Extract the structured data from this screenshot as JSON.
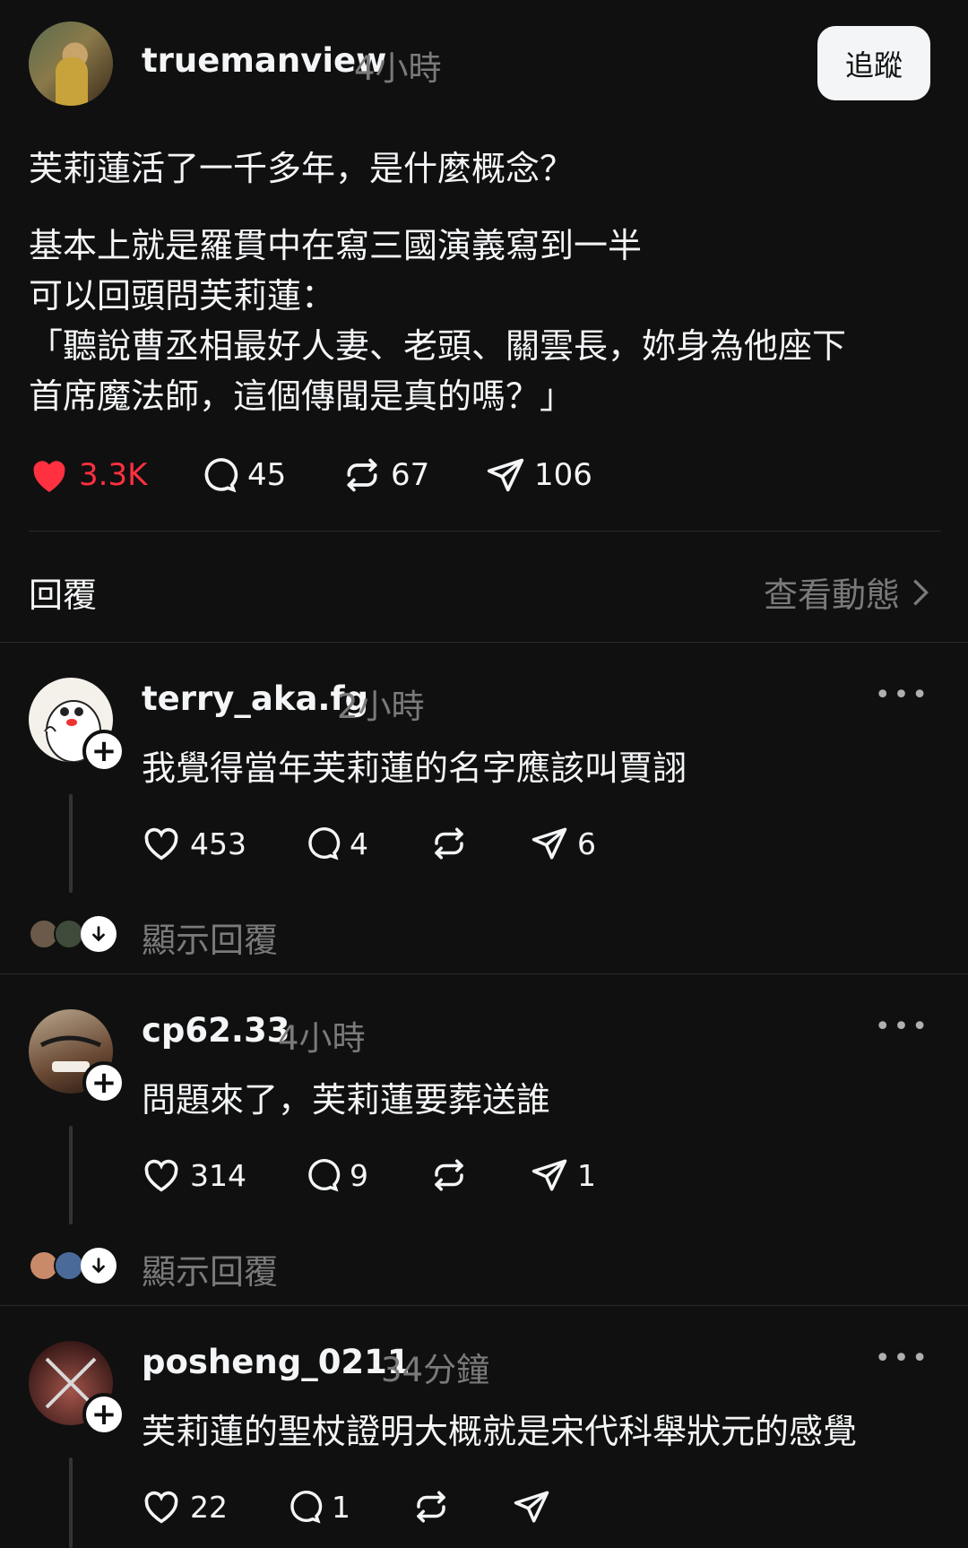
{
  "post": {
    "username": "truemanview",
    "time": "4小時",
    "follow_label": "追蹤",
    "line1": "芙莉蓮活了一千多年，是什麼概念？",
    "line2": "基本上就是羅貫中在寫三國演義寫到一半",
    "line3": "可以回頭問芙莉蓮：",
    "line4": "「聽說曹丞相最好人妻、老頭、關雲長，妳身為他座下",
    "line5": "首席魔法師，這個傳聞是真的嗎？」",
    "likes": "3.3K",
    "comments": "45",
    "reposts": "67",
    "shares": "106"
  },
  "replies_header": {
    "title": "回覆",
    "view_activity": "查看動態"
  },
  "replies": [
    {
      "username": "terry_aka.fg",
      "time": "2小時",
      "text": "我覺得當年芙莉蓮的名字應該叫賈詡",
      "likes": "453",
      "comments": "4",
      "reposts": "",
      "shares": "6",
      "show_replies": "顯示回覆"
    },
    {
      "username": "cp62.33",
      "time": "4小時",
      "text": "問題來了，芙莉蓮要葬送誰",
      "likes": "314",
      "comments": "9",
      "reposts": "",
      "shares": "1",
      "show_replies": "顯示回覆"
    },
    {
      "username": "posheng_0211",
      "time": "34分鐘",
      "text": "芙莉蓮的聖杖證明大概就是宋代科舉狀元的感覺",
      "likes": "22",
      "comments": "1",
      "reposts": "",
      "shares": ""
    }
  ],
  "icons": {
    "like_active_color": "#ff3040",
    "more": "•••"
  }
}
